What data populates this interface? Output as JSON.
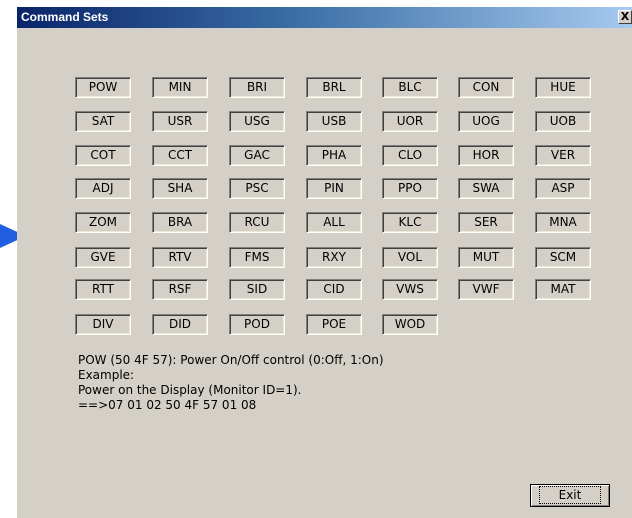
{
  "window": {
    "title": "Command Sets",
    "close_label": "X"
  },
  "commands": [
    [
      "POW",
      "MIN",
      "BRI",
      "BRL",
      "BLC",
      "CON",
      "HUE"
    ],
    [
      "SAT",
      "USR",
      "USG",
      "USB",
      "UOR",
      "UOG",
      "UOB"
    ],
    [
      "COT",
      "CCT",
      "GAC",
      "PHA",
      "CLO",
      "HOR",
      "VER"
    ],
    [
      "ADJ",
      "SHA",
      "PSC",
      "PIN",
      "PPO",
      "SWA",
      "ASP"
    ],
    [
      "ZOM",
      "BRA",
      "RCU",
      "ALL",
      "KLC",
      "SER",
      "MNA"
    ],
    [
      "GVE",
      "RTV",
      "FMS",
      "RXY",
      "VOL",
      "MUT",
      "SCM"
    ],
    [
      "RTT",
      "RSF",
      "SID",
      "CID",
      "VWS",
      "VWF",
      "MAT"
    ],
    [
      "DIV",
      "DID",
      "POD",
      "POE",
      "WOD"
    ]
  ],
  "description": {
    "line1": "POW (50 4F 57): Power On/Off control (0:Off, 1:On)",
    "line2": "Example:",
    "line3": "Power on the Display (Monitor ID=1).",
    "line4": "==>07 01 02 50 4F 57 01 08"
  },
  "buttons": {
    "exit_label": "Exit"
  },
  "colors": {
    "dialog_bg": "#d4d0c8",
    "titlebar_start": "#0a246a",
    "titlebar_end": "#a6caf0",
    "pointer_arrow": "#1f5fe0"
  }
}
